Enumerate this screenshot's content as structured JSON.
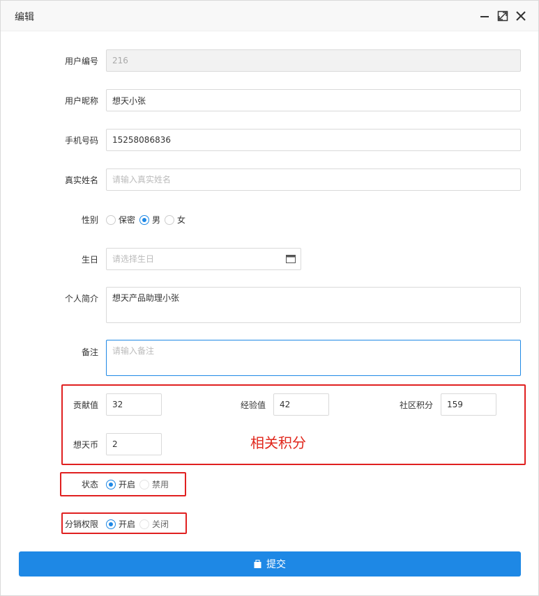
{
  "dialog": {
    "title": "编辑",
    "icons": [
      "minimize-icon",
      "maximize-icon",
      "close-icon"
    ]
  },
  "form": {
    "user_id": {
      "label": "用户编号",
      "value": "216"
    },
    "nickname": {
      "label": "用户昵称",
      "value": "想天小张"
    },
    "phone": {
      "label": "手机号码",
      "value": "15258086836"
    },
    "real_name": {
      "label": "真实姓名",
      "value": "",
      "placeholder": "请输入真实姓名"
    },
    "gender": {
      "label": "性别",
      "options": [
        "保密",
        "男",
        "女"
      ],
      "selected": "男"
    },
    "birthday": {
      "label": "生日",
      "value": "",
      "placeholder": "请选择生日"
    },
    "bio": {
      "label": "个人简介",
      "value": "想天产品助理小张"
    },
    "remark": {
      "label": "备注",
      "value": "",
      "placeholder": "请输入备注"
    },
    "contribution": {
      "label": "贡献值",
      "value": "32"
    },
    "experience": {
      "label": "经验值",
      "value": "42"
    },
    "community_points": {
      "label": "社区积分",
      "value": "159"
    },
    "coins": {
      "label": "想天币",
      "value": "2"
    },
    "status": {
      "label": "状态",
      "options": [
        "开启",
        "禁用"
      ],
      "selected": "开启"
    },
    "distribution": {
      "label": "分销权限",
      "options": [
        "开启",
        "关闭"
      ],
      "selected": "开启"
    }
  },
  "annotation": {
    "points_note": "相关积分",
    "color": "#e0261b"
  },
  "submit": {
    "label": "提交"
  },
  "colors": {
    "primary": "#1e88e5",
    "highlight": "#e02020"
  }
}
